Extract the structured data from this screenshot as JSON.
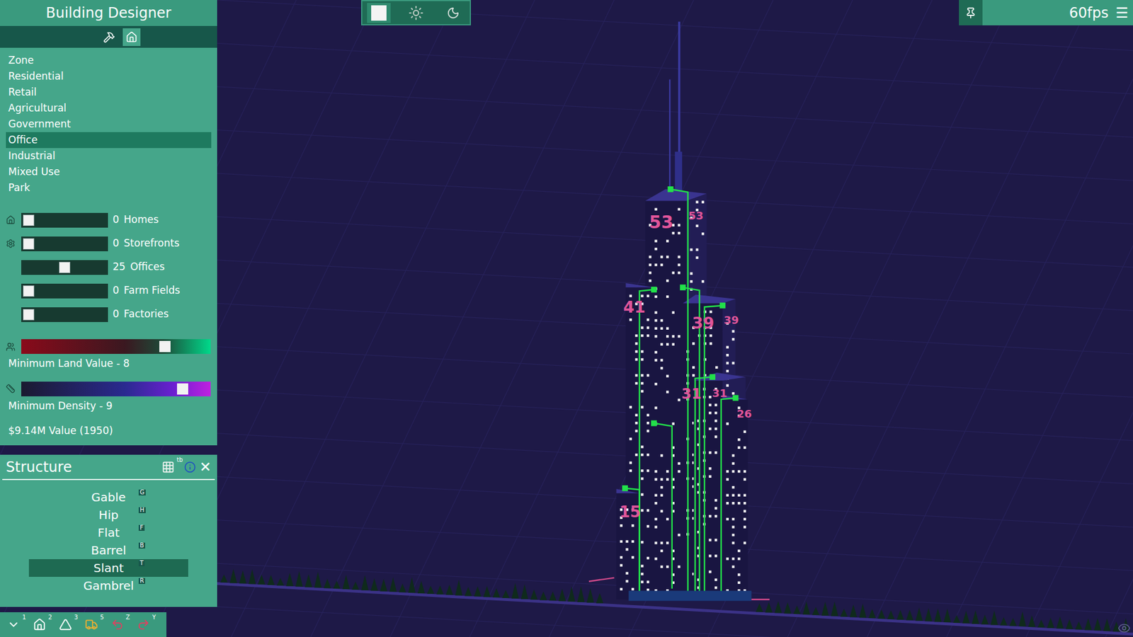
{
  "designer": {
    "title": "Building Designer",
    "tabs": [
      {
        "selected": false
      },
      {
        "selected": true
      }
    ],
    "zones": [
      {
        "label": "Zone",
        "selected": false
      },
      {
        "label": "Residential",
        "selected": false
      },
      {
        "label": "Retail",
        "selected": false
      },
      {
        "label": "Agricultural",
        "selected": false
      },
      {
        "label": "Government",
        "selected": false
      },
      {
        "label": "Office",
        "selected": true
      },
      {
        "label": "Industrial",
        "selected": false
      },
      {
        "label": "Mixed  Use",
        "selected": false
      },
      {
        "label": "Park",
        "selected": false
      }
    ],
    "sliders": [
      {
        "count": "0",
        "label": "Homes",
        "level": 0,
        "kind": "home"
      },
      {
        "count": "0",
        "label": "Storefronts",
        "level": 0,
        "kind": "store"
      },
      {
        "count": "25",
        "label": "Offices",
        "level": 0.5,
        "kind": "plain"
      },
      {
        "count": "0",
        "label": "Farm Fields",
        "level": 0,
        "kind": "plain"
      },
      {
        "count": "0",
        "label": "Factories",
        "level": 0,
        "kind": "plain"
      }
    ],
    "land_value": {
      "label": "Minimum Land Value - 8",
      "level": 0.78
    },
    "density": {
      "label": "Minimum Density - 9",
      "level": 0.88
    },
    "value": "$9.14M Value (1950)"
  },
  "structure": {
    "title": "Structure",
    "grid_key": "tb",
    "close": "✕",
    "items": [
      {
        "label": "Gable",
        "key": "G",
        "selected": false
      },
      {
        "label": "Hip",
        "key": "H",
        "selected": false
      },
      {
        "label": "Flat",
        "key": "F",
        "selected": false
      },
      {
        "label": "Barrel",
        "key": "B",
        "selected": false
      },
      {
        "label": "Slant",
        "key": "T",
        "selected": true
      },
      {
        "label": "Gambrel",
        "key": "R",
        "selected": false
      }
    ]
  },
  "toolbar": [
    {
      "key": "1",
      "kind": "select"
    },
    {
      "key": "2",
      "kind": "home"
    },
    {
      "key": "3",
      "kind": "plant"
    },
    {
      "key": "5",
      "kind": "bulldoze"
    },
    {
      "key": "Z",
      "kind": "undo"
    },
    {
      "key": "Y",
      "kind": "redo"
    }
  ],
  "time_controls": [
    {
      "kind": "pause",
      "selected": true
    },
    {
      "kind": "day",
      "selected": false
    },
    {
      "kind": "night",
      "selected": false
    }
  ],
  "top_right": {
    "fps": "60fps",
    "menu": "☰"
  },
  "floor_labels": [
    "53",
    "53",
    "41",
    "39",
    "39",
    "31",
    "31",
    "26",
    "15"
  ]
}
